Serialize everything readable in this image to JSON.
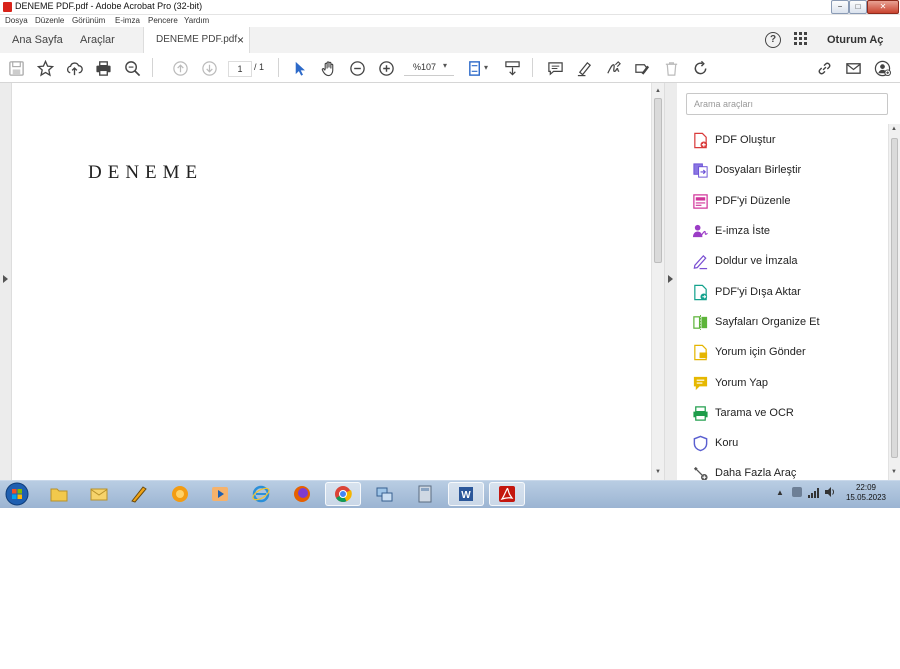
{
  "window": {
    "title": "DENEME PDF.pdf - Adobe Acrobat Pro (32-bit)",
    "controls": [
      "−",
      "□",
      "✕"
    ]
  },
  "menu": [
    "Dosya",
    "Düzenle",
    "Görünüm",
    "E-imza",
    "Pencere",
    "Yardım"
  ],
  "tabs": {
    "home": "Ana Sayfa",
    "tools": "Araçlar",
    "document": "DENEME PDF.pdf",
    "close": "×",
    "help": "?",
    "signin": "Oturum Aç"
  },
  "toolbar": {
    "page_current": "1",
    "page_total": "/ 1",
    "zoom": "%107",
    "icons": [
      "save-icon",
      "bookmark-star-icon",
      "cloud-upload-icon",
      "print-icon",
      "search-zoom-icon",
      "page-up-icon",
      "page-down-icon",
      "select-cursor-icon",
      "hand-icon",
      "zoom-out-icon",
      "zoom-in-icon",
      "fit-page-icon",
      "scroll-mode-icon",
      "comment-icon",
      "highlight-icon",
      "sign-icon",
      "edit-icon",
      "delete-icon",
      "rotate-icon",
      "share-link-icon",
      "email-icon",
      "add-user-icon"
    ]
  },
  "document": {
    "text": "DENEME"
  },
  "tools_pane": {
    "search_placeholder": "Arama araçları",
    "items": [
      {
        "label": "PDF Oluştur",
        "icon": "create-pdf-icon",
        "color": "#d93b3b"
      },
      {
        "label": "Dosyaları Birleştir",
        "icon": "combine-files-icon",
        "color": "#6a4fd6"
      },
      {
        "label": "PDF'yi Düzenle",
        "icon": "edit-pdf-icon",
        "color": "#d0349a"
      },
      {
        "label": "E-imza İste",
        "icon": "request-esign-icon",
        "color": "#9b3cc6"
      },
      {
        "label": "Doldur ve İmzala",
        "icon": "fill-sign-icon",
        "color": "#7a4fd2"
      },
      {
        "label": "PDF'yi Dışa Aktar",
        "icon": "export-pdf-icon",
        "color": "#14a28d"
      },
      {
        "label": "Sayfaları Organize Et",
        "icon": "organize-pages-icon",
        "color": "#5db43a"
      },
      {
        "label": "Yorum için Gönder",
        "icon": "send-comment-icon",
        "color": "#e5b500"
      },
      {
        "label": "Yorum Yap",
        "icon": "comment-tool-icon",
        "color": "#e6b800"
      },
      {
        "label": "Tarama ve OCR",
        "icon": "scan-ocr-icon",
        "color": "#1e9d4a"
      },
      {
        "label": "Koru",
        "icon": "protect-shield-icon",
        "color": "#5a5fd0"
      },
      {
        "label": "Daha Fazla Araç",
        "icon": "more-tools-icon",
        "color": "#555555"
      }
    ]
  },
  "taskbar": {
    "apps": [
      "start-orb-icon",
      "file-explorer-icon",
      "outlook-icon",
      "pencil-app-icon",
      "firefox-orange-icon",
      "media-player-icon",
      "internet-explorer-icon",
      "firefox-icon",
      "chrome-icon",
      "network-app-icon",
      "calculator-icon",
      "word-icon",
      "acrobat-icon"
    ],
    "time": "22:09",
    "date": "15.05.2023"
  },
  "colors": {
    "acrobat_red": "#d8231a",
    "toolbar_blue": "#2d6ac9"
  }
}
